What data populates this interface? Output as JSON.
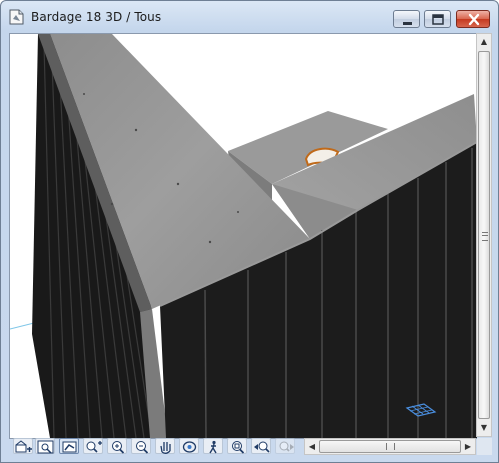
{
  "window": {
    "title": "Bardage 18 3D / Tous",
    "buttons": {
      "minimize": "minimize",
      "maximize": "maximize",
      "close": "close"
    }
  },
  "toolbar": {
    "tools": [
      {
        "icon": "view-settings-icon",
        "active": false
      },
      {
        "icon": "fit-in-window-icon",
        "active": false
      },
      {
        "icon": "orbit-view-icon",
        "active": true
      },
      {
        "icon": "zoom-window-icon",
        "active": false
      },
      {
        "icon": "zoom-in-icon",
        "active": false
      },
      {
        "icon": "zoom-out-icon",
        "active": false
      },
      {
        "icon": "pan-hand-icon",
        "active": false
      },
      {
        "icon": "orbit-icon",
        "active": false
      },
      {
        "icon": "explore-walk-icon",
        "active": false
      },
      {
        "icon": "zoom-extents-icon",
        "active": false
      },
      {
        "icon": "previous-zoom-icon",
        "active": false
      },
      {
        "icon": "next-zoom-icon",
        "active": false
      }
    ]
  },
  "scene": {
    "content": "3D view: concrete cap on dark vertical cladding panels",
    "colors": {
      "sky": "#ffffff",
      "concrete": "#9c9c9c",
      "cladding": "#1e1e1e",
      "accent": "#c06a1a"
    }
  }
}
